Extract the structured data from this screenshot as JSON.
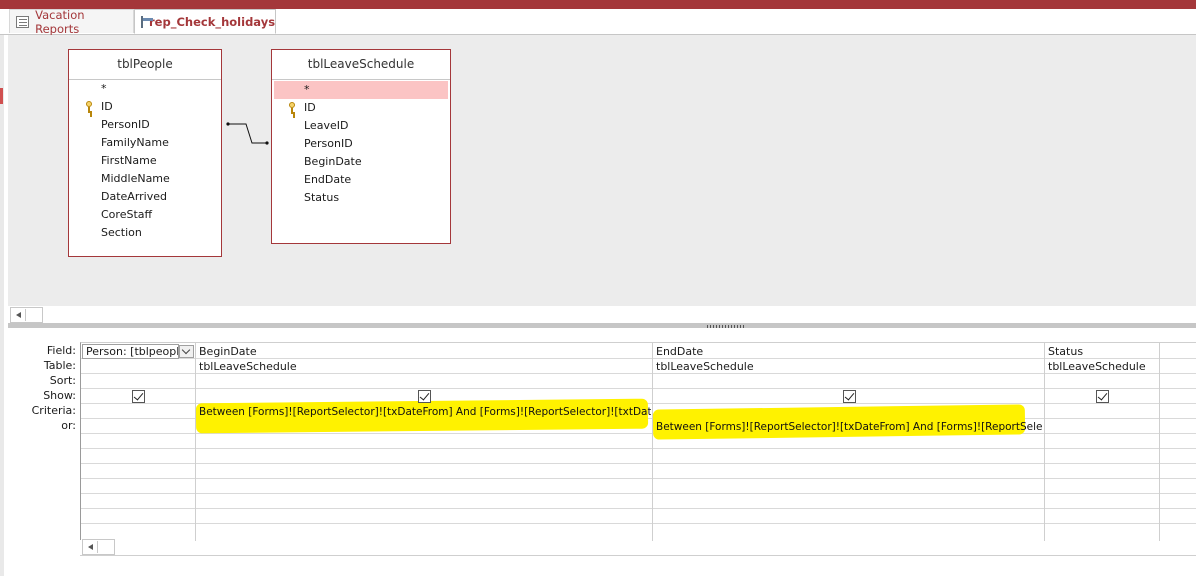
{
  "tabs": [
    {
      "label": "Vacation Reports",
      "icon": "report-icon"
    },
    {
      "label": "rep_Check_holidays",
      "icon": "query-icon"
    }
  ],
  "tables": [
    {
      "title": "tblPeople",
      "fields": [
        "*",
        "ID",
        "PersonID",
        "FamilyName",
        "FirstName",
        "MiddleName",
        "DateArrived",
        "CoreStaff",
        "Section"
      ]
    },
    {
      "title": "tblLeaveSchedule",
      "fields": [
        "*",
        "ID",
        "LeaveID",
        "PersonID",
        "BeginDate",
        "EndDate",
        "Status"
      ]
    }
  ],
  "grid": {
    "row_labels": [
      "Field:",
      "Table:",
      "Sort:",
      "Show:",
      "Criteria:",
      "or:"
    ],
    "columns": [
      {
        "field": "Person: [tblpeople",
        "table": "",
        "sort": "",
        "show": true,
        "criteria": "",
        "or": ""
      },
      {
        "field": "BeginDate",
        "table": "tblLeaveSchedule",
        "sort": "",
        "show": true,
        "criteria": "Between [Forms]![ReportSelector]![txDateFrom] And [Forms]![ReportSelector]![txtDateTo]",
        "or": ""
      },
      {
        "field": "EndDate",
        "table": "tblLeaveSchedule",
        "sort": "",
        "show": true,
        "criteria": "",
        "or": "Between [Forms]![ReportSelector]![txDateFrom] And [Forms]![ReportSelector]"
      },
      {
        "field": "Status",
        "table": "tblLeaveSchedule",
        "sort": "",
        "show": true,
        "criteria": "",
        "or": ""
      }
    ]
  },
  "colors": {
    "accent": "#a4373a",
    "highlight": "#fff200",
    "selected_field": "#fbc4c4",
    "design_bg": "#ececec"
  }
}
